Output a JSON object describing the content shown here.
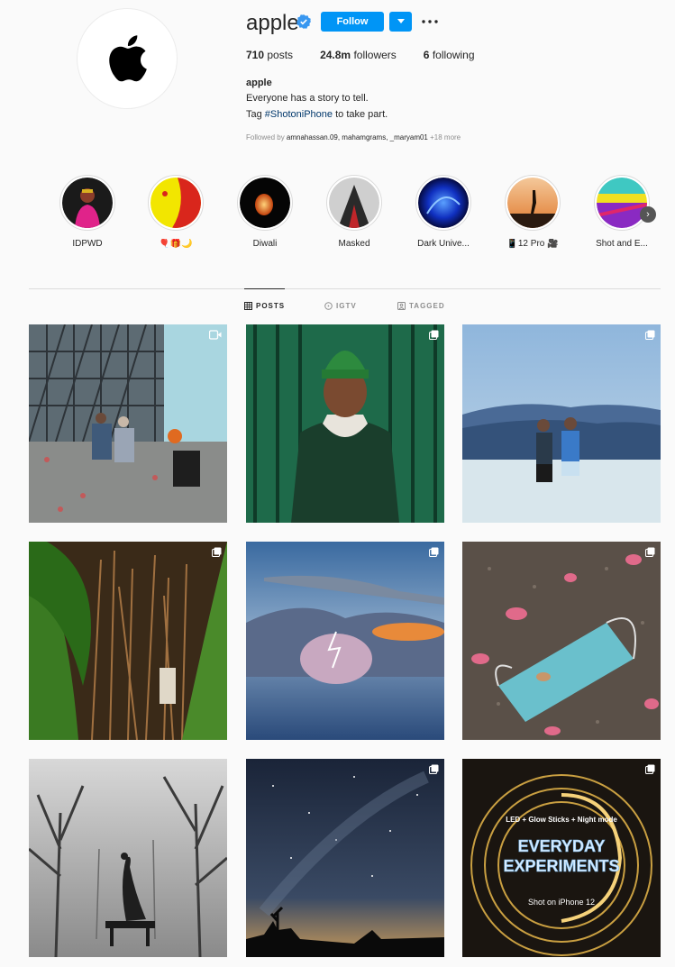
{
  "profile": {
    "username": "apple",
    "follow_label": "Follow",
    "stats": {
      "posts_count": "710",
      "posts_label": "posts",
      "followers_count": "24.8m",
      "followers_label": "followers",
      "following_count": "6",
      "following_label": "following"
    },
    "bio": {
      "name": "apple",
      "line1": "Everyone has a story to tell.",
      "line2_prefix": "Tag ",
      "hashtag": "#ShotoniPhone",
      "line2_suffix": " to take part."
    },
    "followed_by": {
      "prefix": "Followed by ",
      "names": "amnahassan.09, mahamgrams, _maryam01",
      "more": " +18 more"
    }
  },
  "highlights": [
    {
      "label": "IDPWD"
    },
    {
      "label": "🎈🎁🌙"
    },
    {
      "label": "Diwali"
    },
    {
      "label": "Masked"
    },
    {
      "label": "Dark Unive..."
    },
    {
      "label": "📱12 Pro 🎥"
    },
    {
      "label": "Shot and E..."
    }
  ],
  "tabs": {
    "posts": "POSTS",
    "igtv": "IGTV",
    "tagged": "TAGGED"
  },
  "posts": [
    {
      "badge": "video-icon",
      "overlay": []
    },
    {
      "badge": "multi-icon",
      "overlay": []
    },
    {
      "badge": "multi-icon",
      "overlay": []
    },
    {
      "badge": "multi-icon",
      "overlay": []
    },
    {
      "badge": "multi-icon",
      "overlay": []
    },
    {
      "badge": "multi-icon",
      "overlay": []
    },
    {
      "badge": "none",
      "overlay": []
    },
    {
      "badge": "multi-icon",
      "overlay": []
    },
    {
      "badge": "multi-icon",
      "overlay_top": "LED + Glow Sticks + Night mode",
      "overlay_title1": "EVERYDAY",
      "overlay_title2": "EXPERIMENTS",
      "overlay_bottom": "Shot on iPhone 12"
    }
  ],
  "colors": {
    "accent": "#0095f6",
    "verified": "#3897f0",
    "hashtag": "#00376b",
    "muted": "#8e8e8e"
  }
}
